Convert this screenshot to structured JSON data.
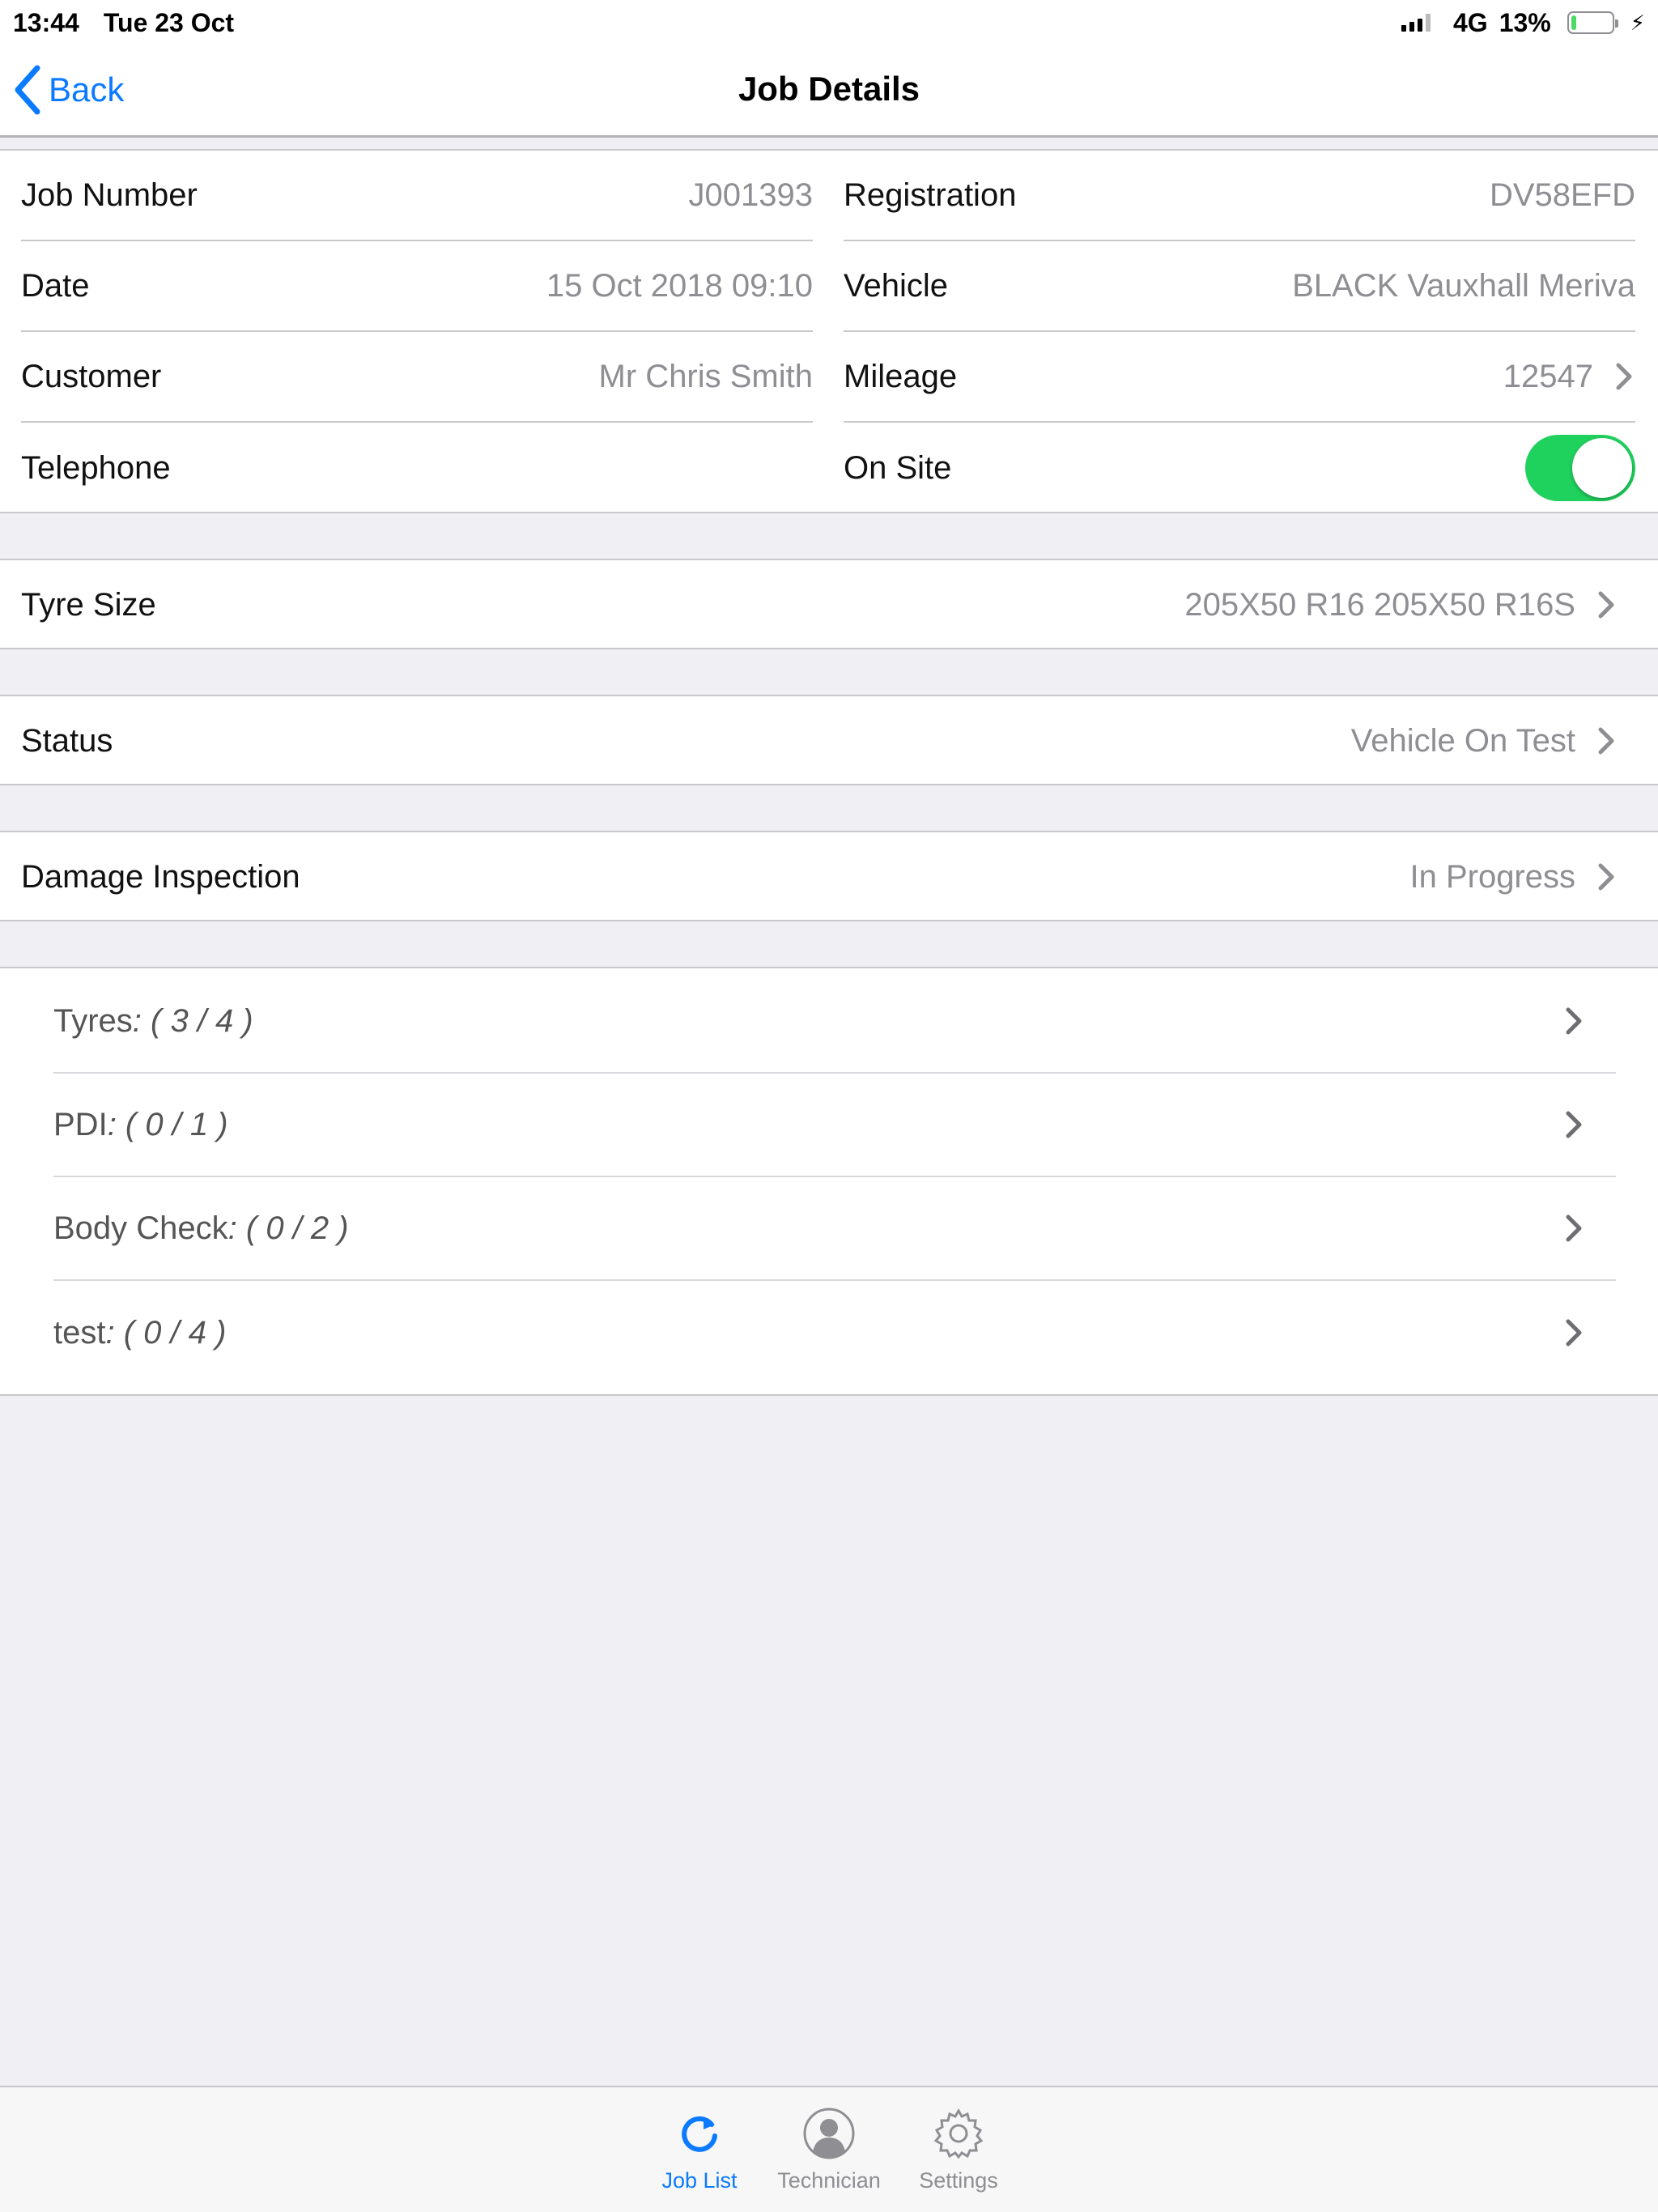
{
  "status_bar": {
    "time": "13:44",
    "date": "Tue 23 Oct",
    "network": "4G",
    "battery": "13%",
    "battery_level": 0.13
  },
  "nav": {
    "back_label": "Back",
    "title": "Job Details"
  },
  "details": {
    "left": [
      {
        "label": "Job Number",
        "value": "J001393"
      },
      {
        "label": "Date",
        "value": "15 Oct 2018 09:10"
      },
      {
        "label": "Customer",
        "value": "Mr Chris Smith"
      },
      {
        "label": "Telephone",
        "value": ""
      }
    ],
    "right": [
      {
        "label": "Registration",
        "value": "DV58EFD"
      },
      {
        "label": "Vehicle",
        "value": "BLACK Vauxhall Meriva"
      },
      {
        "label": "Mileage",
        "value": "12547"
      },
      {
        "label": "On Site",
        "toggle_on": true
      }
    ]
  },
  "tyre_size": {
    "label": "Tyre Size",
    "value": "205X50 R16 205X50 R16S"
  },
  "status": {
    "label": "Status",
    "value": "Vehicle On Test"
  },
  "damage_inspection": {
    "label": "Damage Inspection",
    "value": "In Progress"
  },
  "checklists": [
    {
      "name": "Tyres",
      "count": ": ( 3 / 4 )"
    },
    {
      "name": "PDI",
      "count": ": ( 0 / 1 )"
    },
    {
      "name": "Body Check",
      "count": ": ( 0 / 2 )"
    },
    {
      "name": "test",
      "count": ": ( 0 / 4 )"
    }
  ],
  "tabs": [
    {
      "label": "Job List",
      "icon": "refresh-icon",
      "active": true
    },
    {
      "label": "Technician",
      "icon": "user-icon",
      "active": false
    },
    {
      "label": "Settings",
      "icon": "gear-icon",
      "active": false
    }
  ],
  "colors": {
    "accent": "#0a7aff",
    "toggle_on": "#1fd15d",
    "battery": "#4cd964",
    "value_text": "#8e8e93",
    "background": "#efeff4"
  }
}
